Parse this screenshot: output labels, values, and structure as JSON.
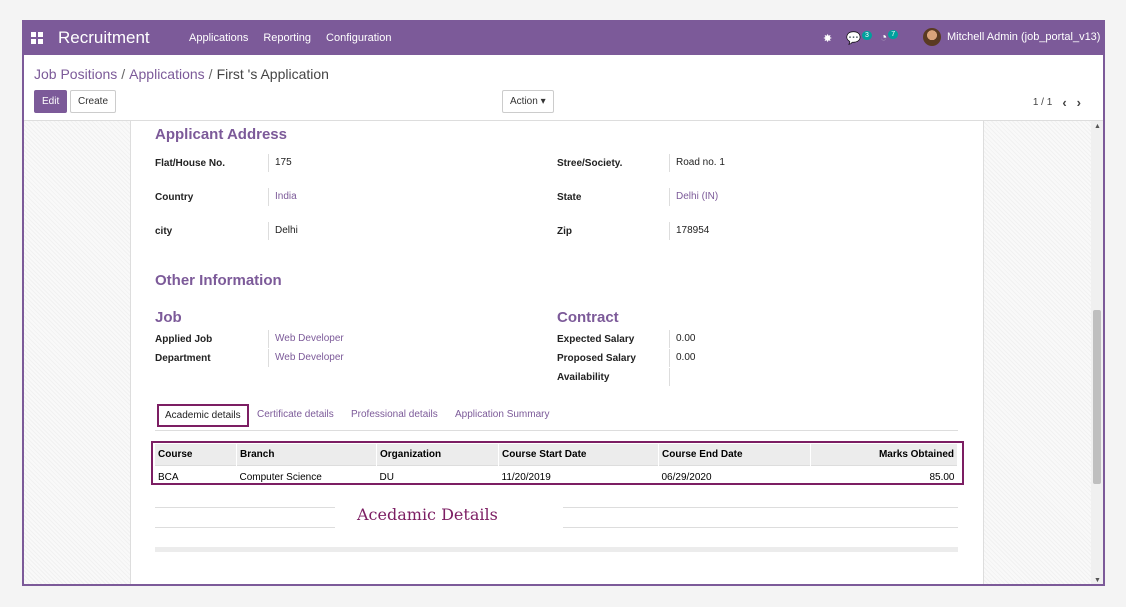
{
  "navbar": {
    "app_name": "Recruitment",
    "menu": [
      "Applications",
      "Reporting",
      "Configuration"
    ],
    "chat_count": "3",
    "activity_count": "7",
    "user_name": "Mitchell Admin (job_portal_v13)"
  },
  "breadcrumb": {
    "job_positions": "Job Positions",
    "applications": "Applications",
    "current": "First 's Application"
  },
  "buttons": {
    "edit": "Edit",
    "create": "Create",
    "action": "Action"
  },
  "pager": "1 / 1",
  "address": {
    "title": "Applicant Address",
    "flat_label": "Flat/House No.",
    "flat_value": "175",
    "street_label": "Stree/Society.",
    "street_value": "Road no. 1",
    "country_label": "Country",
    "country_value": "India",
    "state_label": "State",
    "state_value": "Delhi (IN)",
    "city_label": "city",
    "city_value": "Delhi",
    "zip_label": "Zip",
    "zip_value": "178954"
  },
  "other": {
    "title": "Other Information",
    "job_title": "Job",
    "applied_job_label": "Applied Job",
    "applied_job_value": "Web Developer",
    "department_label": "Department",
    "department_value": "Web Developer",
    "contract_title": "Contract",
    "expected_salary_label": "Expected Salary",
    "expected_salary_value": "0.00",
    "proposed_salary_label": "Proposed Salary",
    "proposed_salary_value": "0.00",
    "availability_label": "Availability",
    "availability_value": ""
  },
  "tabs": [
    "Academic details",
    "Certificate details",
    "Professional details",
    "Application Summary"
  ],
  "academic": {
    "columns": [
      "Course",
      "Branch",
      "Organization",
      "Course Start Date",
      "Course End Date",
      "Marks Obtained"
    ],
    "rows": [
      [
        "BCA",
        "Computer Science",
        "DU",
        "11/20/2019",
        "06/29/2020",
        "85.00"
      ]
    ]
  },
  "annotation": "Acedamic  Details"
}
